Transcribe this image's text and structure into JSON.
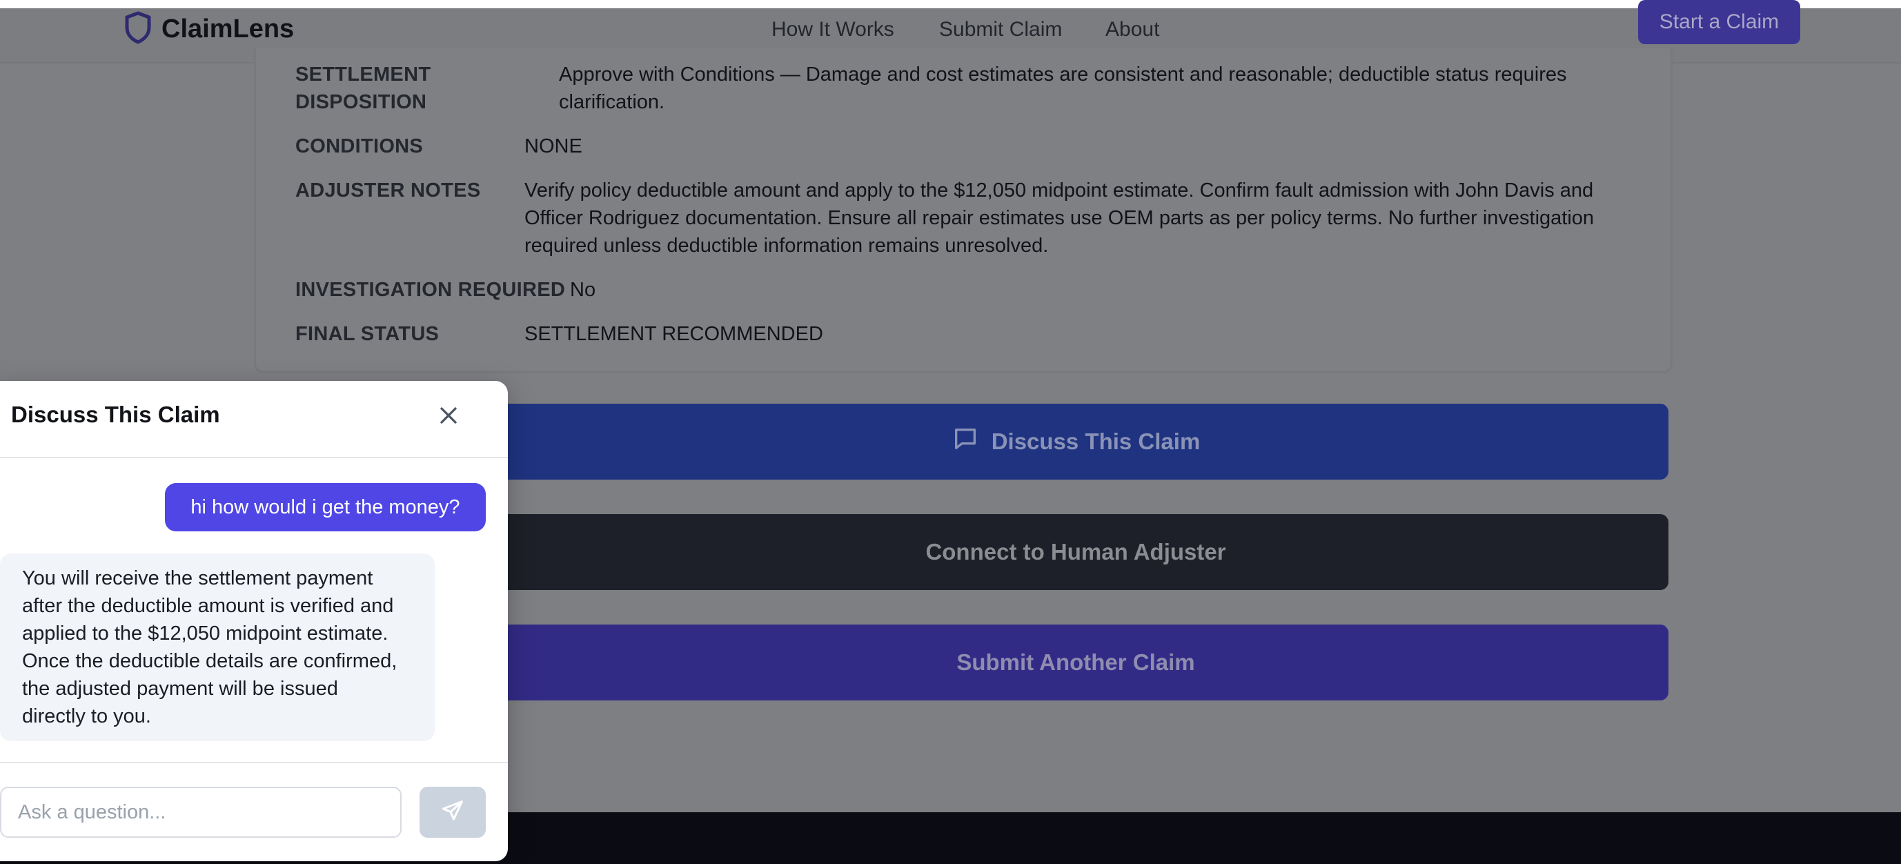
{
  "header": {
    "brand": "ClaimLens",
    "nav": [
      "How It Works",
      "Submit Claim",
      "About"
    ],
    "cta": "Start a Claim"
  },
  "summary": {
    "settlement_label_1": "SETTLEMENT",
    "settlement_label_2": "DISPOSITION",
    "settlement_value_1": "Approve with Conditions — Damage and cost estimates are consistent and reasonable; deductible status requires",
    "settlement_value_2": "clarification.",
    "conditions_label": "CONDITIONS",
    "conditions_value": "NONE",
    "notes_label": "ADJUSTER NOTES",
    "notes_value_1": "Verify policy deductible amount and apply to the $12,050 midpoint estimate. Confirm fault admission with John Davis and",
    "notes_value_2": "Officer Rodriguez documentation. Ensure all repair estimates use OEM parts as per policy terms. No further investigation",
    "notes_value_3": "required unless deductible information remains unresolved.",
    "investigation_label": "INVESTIGATION REQUIRED",
    "investigation_value": "No",
    "status_label": "FINAL STATUS",
    "status_value": "SETTLEMENT RECOMMENDED"
  },
  "actions": {
    "discuss": "Discuss This Claim",
    "human": "Connect to Human Adjuster",
    "another": "Submit Another Claim"
  },
  "chat": {
    "title": "Discuss This Claim",
    "user_message": "hi how would i get the money?",
    "bot_message_lines": [
      "You will receive the settlement payment",
      "after the deductible amount is verified and",
      "applied to the $12,050 midpoint estimate.",
      "Once the deductible details are confirmed,",
      "the adjusted payment will be issued",
      "directly to you."
    ],
    "input_placeholder": "Ask a question...",
    "input_value": ""
  },
  "icons": {
    "logo": "shield-icon",
    "discuss": "chat-bubble-icon",
    "close": "close-icon",
    "send": "send-icon"
  },
  "colors": {
    "accent": "#4f46e5",
    "discuss_button": "#1f3381",
    "human_button": "#1d2028",
    "another_button": "#322b86"
  }
}
